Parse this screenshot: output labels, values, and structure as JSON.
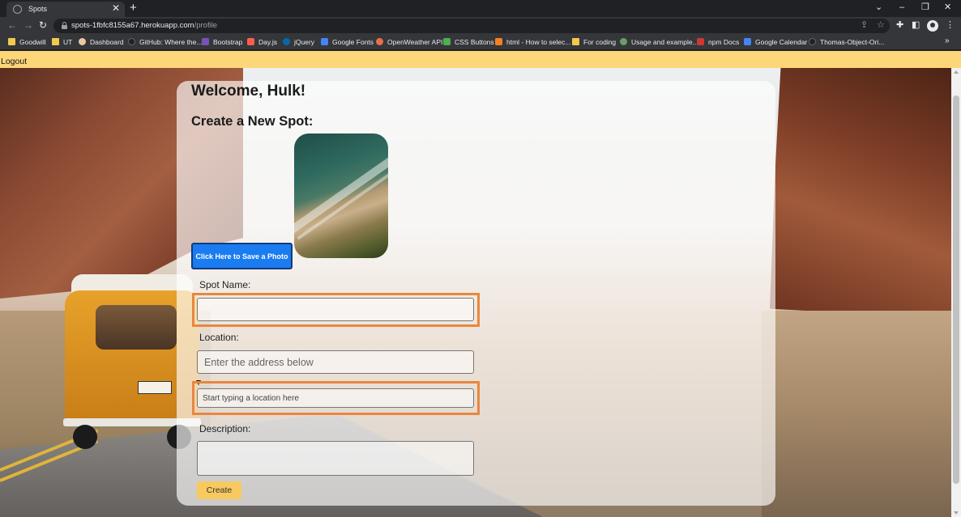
{
  "browser": {
    "tab": {
      "title": "Spots",
      "close": "✕"
    },
    "new_tab": "+",
    "window_controls": {
      "dropdown": "⌄",
      "minimize": "–",
      "restore": "❐",
      "close": "✕"
    },
    "url_host": "spots-1fbfc8155a67.herokuapp.com",
    "url_path": "/profile",
    "more": "⋮",
    "bookmarks": [
      {
        "label": "Goodwill",
        "icon": "folder-icon",
        "color": "#f2c94c"
      },
      {
        "label": "UT",
        "icon": "folder-icon",
        "color": "#f2c94c"
      },
      {
        "label": "Dashboard",
        "icon": "dashboard-icon",
        "color": "#e8c9a2"
      },
      {
        "label": "GitHub: Where the...",
        "icon": "github-icon",
        "color": "#202124"
      },
      {
        "label": "Bootstrap",
        "icon": "bootstrap-icon",
        "color": "#7952b3"
      },
      {
        "label": "Day.js",
        "icon": "dayjs-icon",
        "color": "#ff5f4c"
      },
      {
        "label": "jQuery",
        "icon": "jquery-icon",
        "color": "#0769ad"
      },
      {
        "label": "Google Fonts",
        "icon": "google-fonts-icon",
        "color": "#4285f4"
      },
      {
        "label": "OpenWeather API",
        "icon": "openweather-icon",
        "color": "#eb6e4b"
      },
      {
        "label": "CSS Buttons",
        "icon": "css-buttons-icon",
        "color": "#4caf50"
      },
      {
        "label": "html - How to selec...",
        "icon": "stackoverflow-icon",
        "color": "#f48024"
      },
      {
        "label": "For coding",
        "icon": "folder-icon",
        "color": "#f2c94c"
      },
      {
        "label": "Usage and example...",
        "icon": "node-icon",
        "color": "#68a063"
      },
      {
        "label": "npm Docs",
        "icon": "npm-icon",
        "color": "#cb3837"
      },
      {
        "label": "Google Calendar",
        "icon": "calendar-icon",
        "color": "#4285f4"
      },
      {
        "label": "Thomas-Object-Ori...",
        "icon": "github-icon",
        "color": "#202124"
      }
    ],
    "bookmarks_more": "»"
  },
  "page": {
    "logout": "Logout",
    "welcome": "Welcome, Hulk!",
    "create_heading": "Create a New Spot:",
    "photo_button": "Click Here to Save a Photo",
    "spot_name_label": "Spot Name:",
    "spot_name_value": "",
    "location_label": "Location:",
    "address_placeholder": "Enter the address below",
    "autocomplete_placeholder": "Start typing a location here",
    "description_label": "Description:",
    "create_button": "Create"
  },
  "colors": {
    "navbar": "#fdd67a",
    "photo_button": "#1a7cf0",
    "create_button": "#f7c95f",
    "highlight": "#e9873e"
  }
}
